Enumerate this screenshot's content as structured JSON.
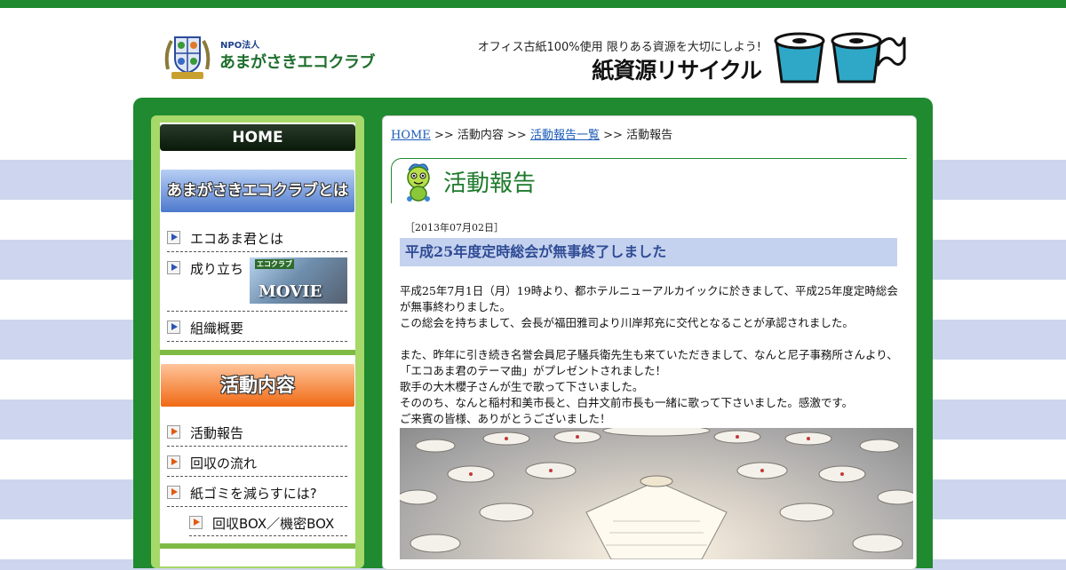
{
  "header": {
    "logo_sub": "NPO法人",
    "logo_name": "あまがさきエコクラブ",
    "tagline": "オフィス古紙100%使用 限りある資源を大切にしよう!",
    "recycle_title": "紙資源リサイクル"
  },
  "sidebar": {
    "home": "HOME",
    "section1_title": "あまがさきエコクラブとは",
    "section1_items": [
      "エコあま君とは",
      "成り立ち",
      "組織概要"
    ],
    "movie_tag": "エコクラブ",
    "movie_label": "MOVIE",
    "section2_title": "活動内容",
    "section2_items": [
      "活動報告",
      "回収の流れ",
      "紙ゴミを減らすには?",
      "回収BOX／機密BOX"
    ]
  },
  "breadcrumb": {
    "home": "HOME",
    "sep": ">>",
    "activities": "活動内容",
    "list": "活動報告一覧",
    "current": "活動報告"
  },
  "page_title": "活動報告",
  "article": {
    "date": "［2013年07月02日］",
    "title": "平成25年度定時総会が無事終了しました",
    "p1": "平成25年7月1日（月）19時より、都ホテルニューアルカイックに於きまして、平成25年度定時総会が無事終わりました。",
    "p2": "この総会を持ちまして、会長が福田雅司より川岸邦充に交代となることが承認されました。",
    "p3": "また、昨年に引き続き名誉会員尼子騒兵衛先生も来ていただきまして、なんと尼子事務所さんより、「エコあま君のテーマ曲」がプレゼントされました！",
    "p4": "歌手の大木櫻子さんが生で歌って下さいました。",
    "p5": "そののち、なんと稲村和美市長と、白井文前市長も一緒に歌って下さいました。感激です。",
    "p6": "ご来賓の皆様、ありがとうございました！"
  },
  "colors": {
    "brand_green": "#1e8a30",
    "sidebar_green": "#a6d86a",
    "stripe_blue": "#cdd6ee",
    "title_bg": "#c5d2ef",
    "title_text": "#2f4c95"
  }
}
